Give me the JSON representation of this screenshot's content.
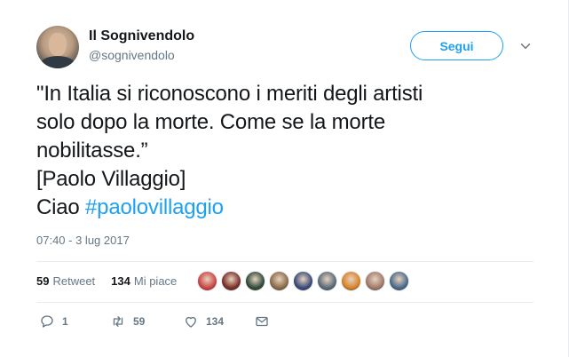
{
  "user": {
    "name": "Il Sognivendolo",
    "handle": "@sognivendolo"
  },
  "follow_label": "Segui",
  "tweet": {
    "line1": "\"In Italia si riconoscono i meriti degli artisti",
    "line2": "solo dopo la morte. Come se la morte",
    "line3": "nobilitasse.”",
    "line4": "[Paolo Villaggio]",
    "ciao": "Ciao ",
    "hashtag": "#paolovillaggio"
  },
  "timestamp": "07:40 - 3 lug 2017",
  "stats": {
    "retweet_count": "59",
    "retweet_label": "Retweet",
    "like_count": "134",
    "like_label": "Mi piace"
  },
  "liker_avatars": [
    {
      "color": "#c44"
    },
    {
      "color": "#7a2e2a"
    },
    {
      "color": "#2e4a3a"
    },
    {
      "color": "#8a6a4a"
    },
    {
      "color": "#3a4a7a"
    },
    {
      "color": "#5a6a7a"
    },
    {
      "color": "#d9822b"
    },
    {
      "color": "#a07a6a"
    },
    {
      "color": "#4a6a8a"
    }
  ],
  "actions": {
    "reply_count": "1",
    "retweet_count": "59",
    "like_count": "134"
  },
  "colors": {
    "accent": "#1da1f2",
    "secondary_text": "#657786",
    "primary_text": "#14171a"
  }
}
